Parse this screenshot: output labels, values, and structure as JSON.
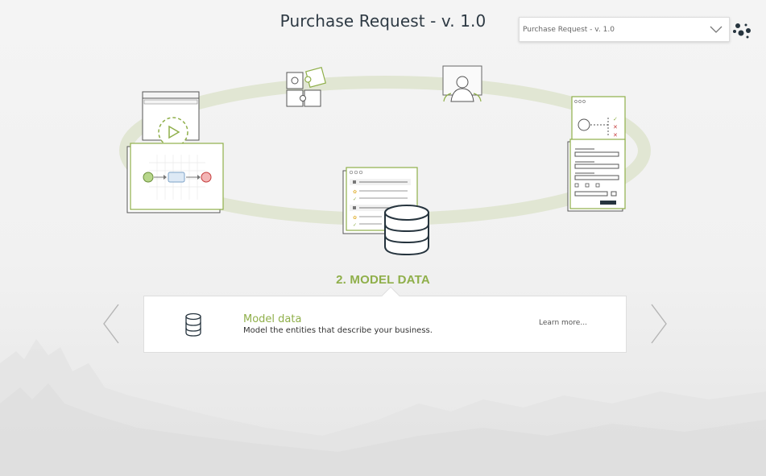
{
  "header": {
    "title": "Purchase Request - v. 1.0"
  },
  "version_select": {
    "selected": "Purchase Request - v. 1.0"
  },
  "step": {
    "label": "2. MODEL DATA"
  },
  "card": {
    "title": "Model data",
    "description": "Model the entities that describe your business.",
    "link": "Learn more..."
  },
  "colors": {
    "accent_green": "#8faf4a",
    "title_dark": "#2e3a44",
    "ring": "#e3e8d6"
  },
  "icons": [
    "chevron-down-icon",
    "app-menu-dots-icon",
    "database-icon",
    "chevron-left-icon",
    "chevron-right-icon"
  ]
}
